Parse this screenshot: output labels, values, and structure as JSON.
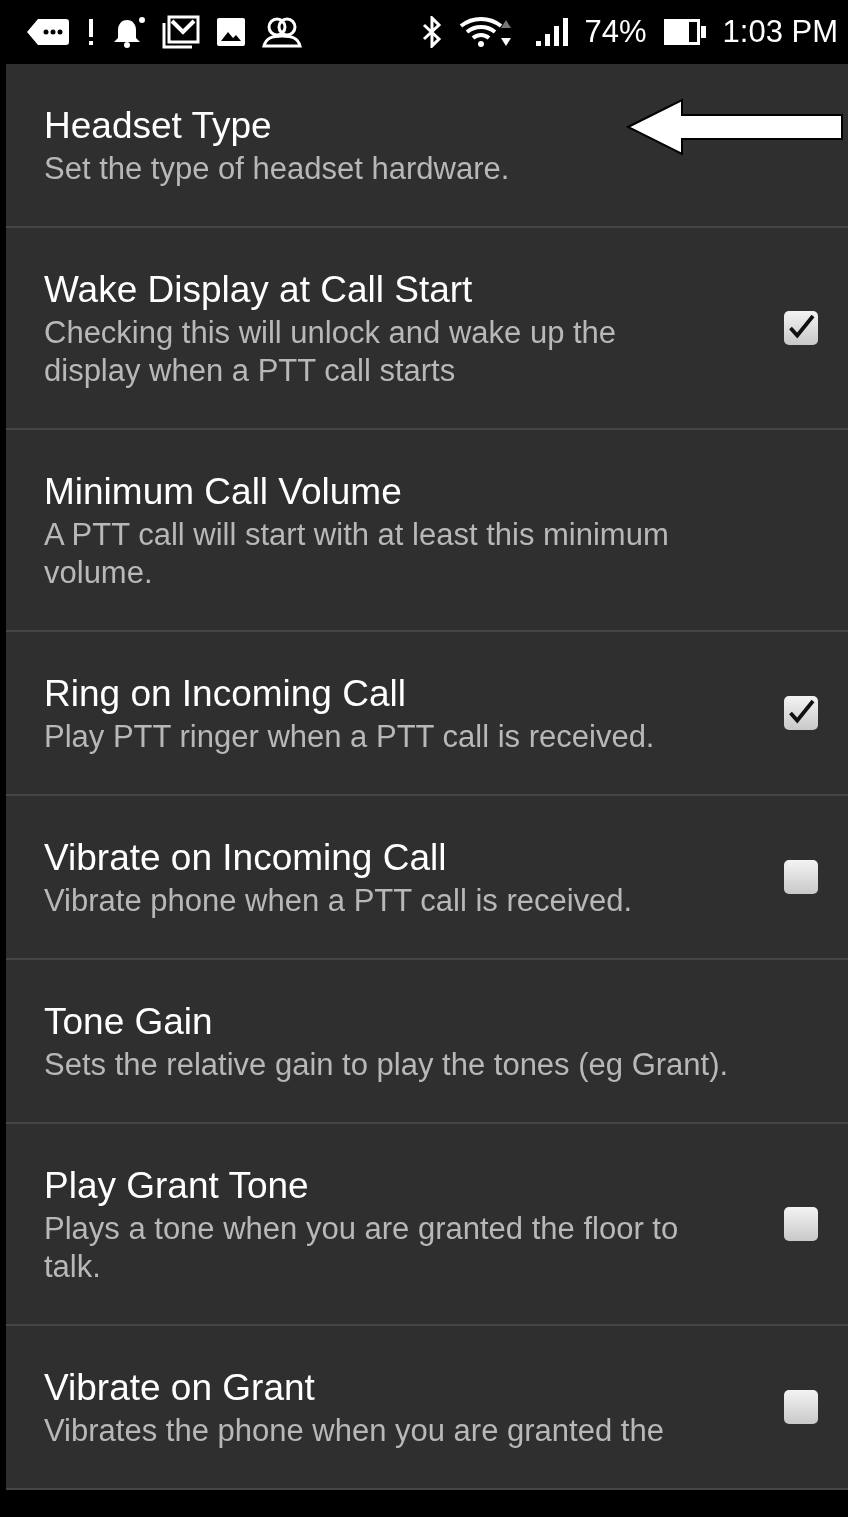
{
  "status_bar": {
    "battery_percent": "74%",
    "time": "1:03 PM"
  },
  "settings": [
    {
      "kind": "plain",
      "title": "Headset Type",
      "summary": "Set the type of headset hardware.",
      "annotated": true
    },
    {
      "kind": "checkbox",
      "title": "Wake Display at Call Start",
      "summary": "Checking this will unlock and wake up the display when a PTT call starts",
      "checked": true
    },
    {
      "kind": "plain",
      "title": "Minimum Call Volume",
      "summary": "A PTT call will start with at least this minimum volume."
    },
    {
      "kind": "checkbox",
      "title": "Ring on Incoming Call",
      "summary": "Play PTT ringer when a PTT call is received.",
      "checked": true
    },
    {
      "kind": "checkbox",
      "title": "Vibrate on Incoming Call",
      "summary": "Vibrate phone when a PTT call is received.",
      "checked": false
    },
    {
      "kind": "plain",
      "title": "Tone Gain",
      "summary": "Sets the relative gain to play the tones (eg Grant)."
    },
    {
      "kind": "checkbox",
      "title": "Play Grant Tone",
      "summary": "Plays a tone when you are granted the floor to talk.",
      "checked": false
    },
    {
      "kind": "checkbox",
      "title": "Vibrate on Grant",
      "summary": "Vibrates the phone when you are granted the",
      "checked": false
    }
  ]
}
